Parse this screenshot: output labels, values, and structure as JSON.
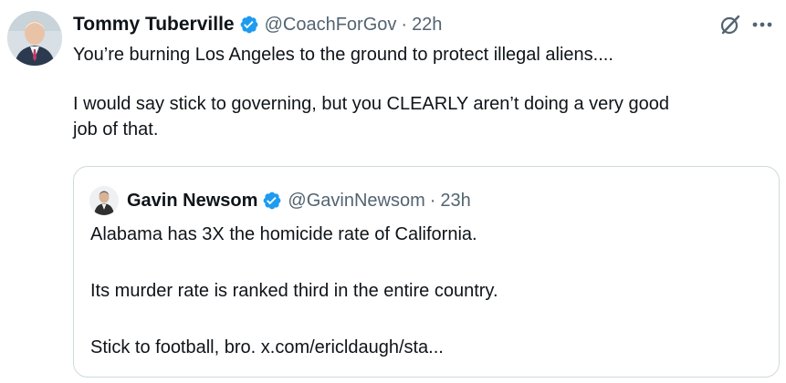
{
  "tweet": {
    "author_name": "Tommy Tuberville",
    "handle": "@CoachForGov",
    "separator": "·",
    "time": "22h",
    "text_line_1": "You’re burning Los Angeles to the ground to protect illegal aliens....",
    "text_line_2": "I would say stick to governing, but you CLEARLY aren’t doing a very good",
    "text_line_3": "job of that."
  },
  "quote": {
    "author_name": "Gavin Newsom",
    "handle": "@GavinNewsom",
    "separator": "·",
    "time": "23h",
    "line_1": "Alabama has 3X the homicide rate of California.",
    "line_2": "Its murder rate is ranked third in the entire country.",
    "line_3": "Stick to football, bro. x.com/ericldaugh/sta..."
  },
  "icons": {
    "verified_badge": "verified-badge-icon",
    "grok": "grok-icon",
    "more": "more-icon"
  },
  "colors": {
    "verified_blue": "#1d9bf0",
    "text_primary": "#0f1419",
    "text_secondary": "#536471",
    "border": "#cfd9de"
  }
}
